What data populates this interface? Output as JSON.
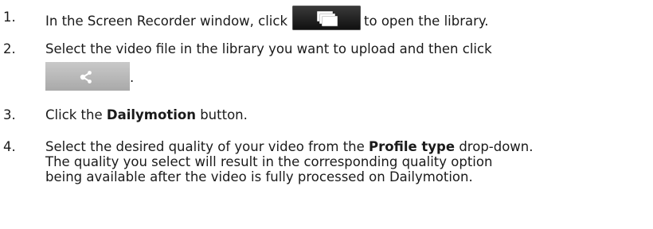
{
  "steps": [
    {
      "number": "1.",
      "text_before": "In the Screen Recorder window, click",
      "text_after": "to open the library."
    },
    {
      "number": "2.",
      "text": "Select the video file in the library you want to upload and then click",
      "trailing": "."
    },
    {
      "number": "3.",
      "text_before": "Click the ",
      "bold": "Dailymotion",
      "text_after": " button."
    },
    {
      "number": "4.",
      "text_before": "Select the desired quality of your video from the ",
      "bold": "Profile type",
      "text_after": " drop-down.",
      "line2": "The quality you select will result in the corresponding quality option",
      "line3": "being available after the video is fully processed on Dailymotion."
    }
  ],
  "icons": {
    "library_button": "library-stack-icon",
    "share_button": "share-icon"
  },
  "colors": {
    "library_button": "#1f1f1f",
    "share_button": "#b8b8b8"
  }
}
